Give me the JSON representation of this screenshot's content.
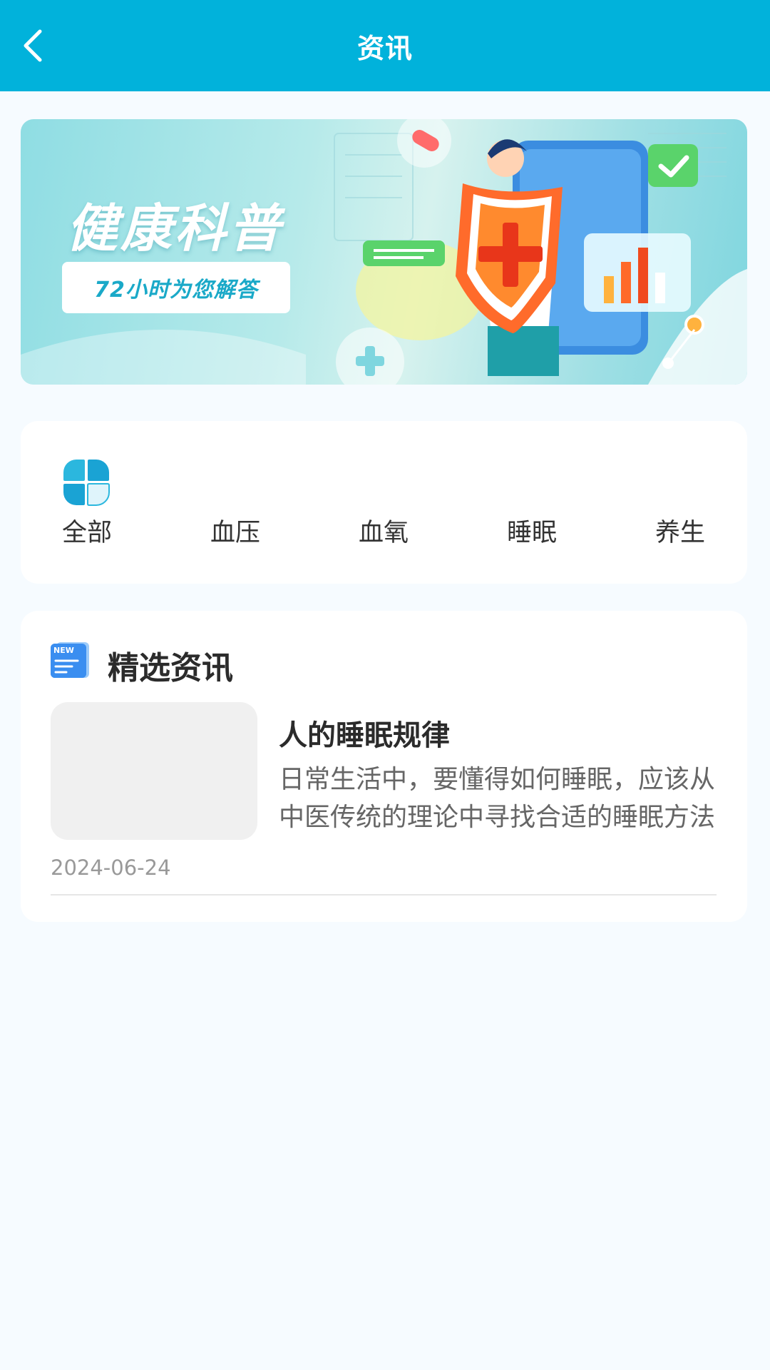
{
  "header": {
    "title": "资讯"
  },
  "banner": {
    "title": "健康科普",
    "subtitle": "72小时为您解答"
  },
  "categories": [
    {
      "label": "全部"
    },
    {
      "label": "血压"
    },
    {
      "label": "血氧"
    },
    {
      "label": "睡眠"
    },
    {
      "label": "养生"
    }
  ],
  "featured": {
    "title": "精选资讯",
    "badge": "NEW",
    "articles": [
      {
        "title": "人的睡眠规律",
        "summary": "日常生活中，要懂得如何睡眠，应该从中医传统的理论中寻找合适的睡眠方法",
        "date": "2024-06-24"
      }
    ]
  },
  "colors": {
    "header_bg": "#01b2db",
    "page_bg": "#f6fbff",
    "accent": "#16b5d8"
  },
  "icons": {
    "back": "chevron-left-icon",
    "category_all": "grid-blocks-icon",
    "news": "news-doc-icon"
  }
}
